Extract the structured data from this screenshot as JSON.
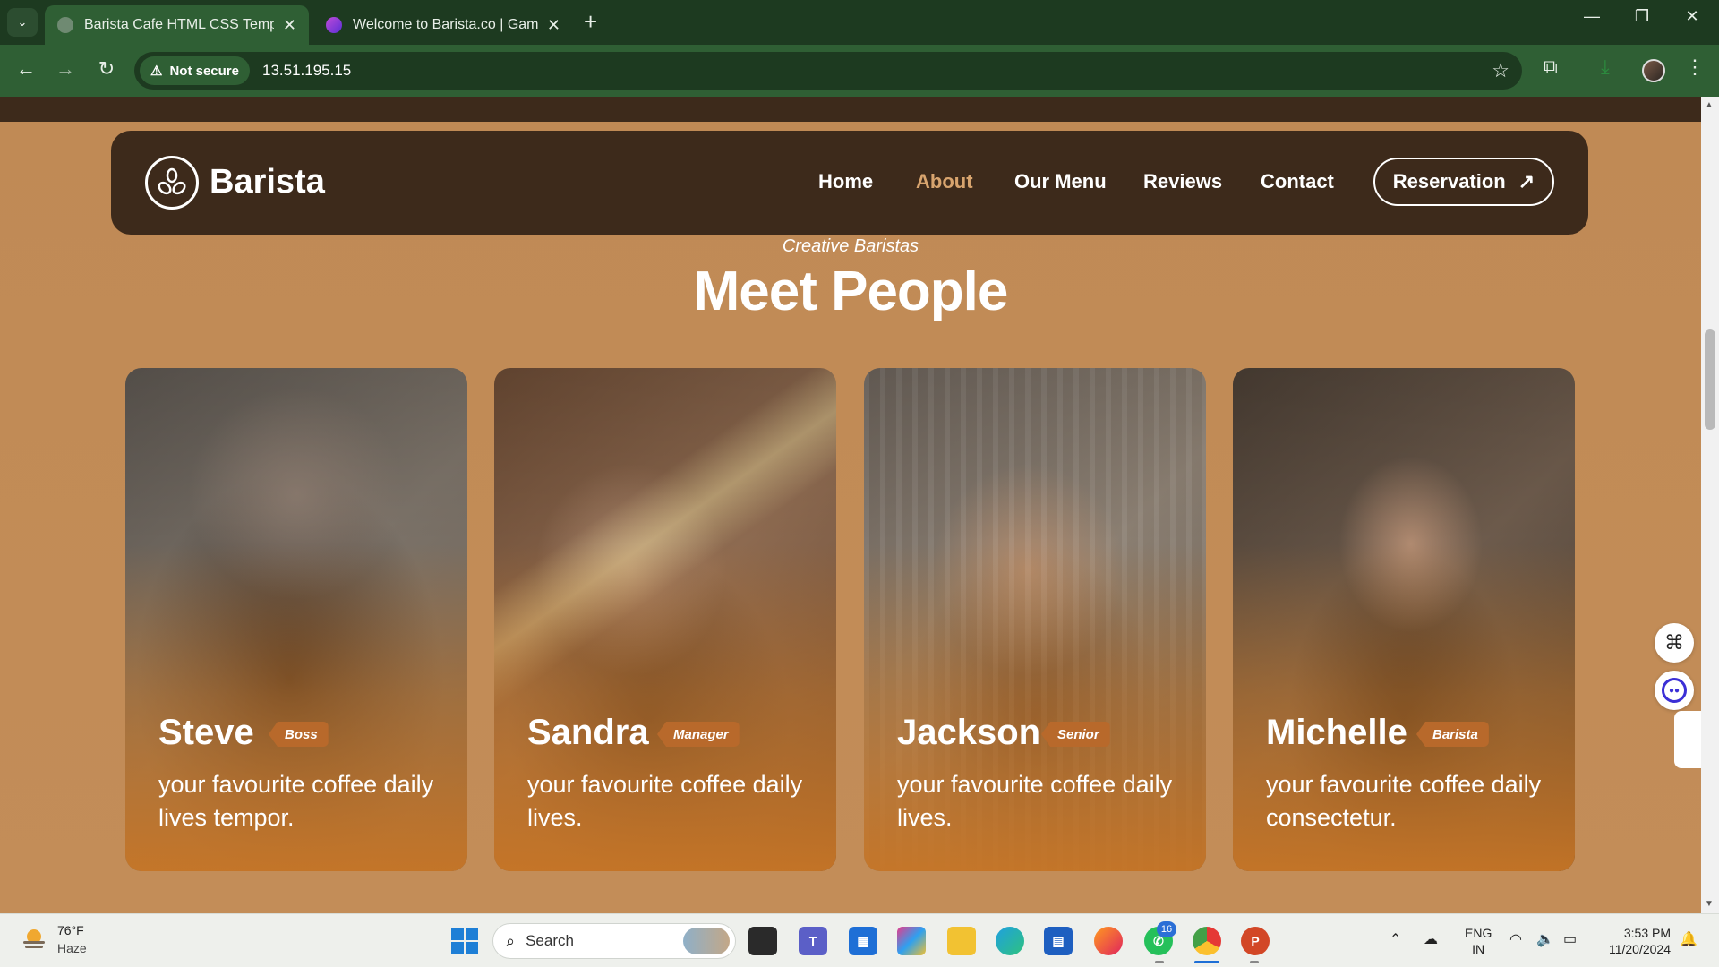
{
  "browser": {
    "tabs": [
      {
        "title": "Barista Cafe HTML CSS Templat",
        "active": true
      },
      {
        "title": "Welcome to Barista.co | Gamma",
        "active": false
      }
    ],
    "security_label": "Not secure",
    "url": "13.51.195.15"
  },
  "site": {
    "brand": "Barista",
    "nav": {
      "home": "Home",
      "about": "About",
      "menu": "Our Menu",
      "reviews": "Reviews",
      "contact": "Contact"
    },
    "active_nav": "About",
    "reservation": "Reservation",
    "section_subtitle": "Creative Baristas",
    "section_title": "Meet People",
    "team": [
      {
        "name": "Steve",
        "role": "Boss",
        "desc": "your favourite coffee daily lives tempor."
      },
      {
        "name": "Sandra",
        "role": "Manager",
        "desc": "your favourite coffee daily lives."
      },
      {
        "name": "Jackson",
        "role": "Senior",
        "desc": "your favourite coffee daily lives."
      },
      {
        "name": "Michelle",
        "role": "Barista",
        "desc": "your favourite coffee daily consectetur."
      }
    ]
  },
  "taskbar": {
    "weather_temp": "76°F",
    "weather_cond": "Haze",
    "search_placeholder": "Search",
    "whatsapp_badge": "16",
    "lang_line1": "ENG",
    "lang_line2": "IN",
    "time": "3:53 PM",
    "date": "11/20/2024"
  },
  "colors": {
    "page_bg": "#c08a55",
    "navbar_bg": "#3d2a1b",
    "active_nav": "#d8a46e",
    "badge": "#b8692b",
    "chrome_dark": "#1d3a20",
    "chrome_mid": "#2f5f34"
  }
}
